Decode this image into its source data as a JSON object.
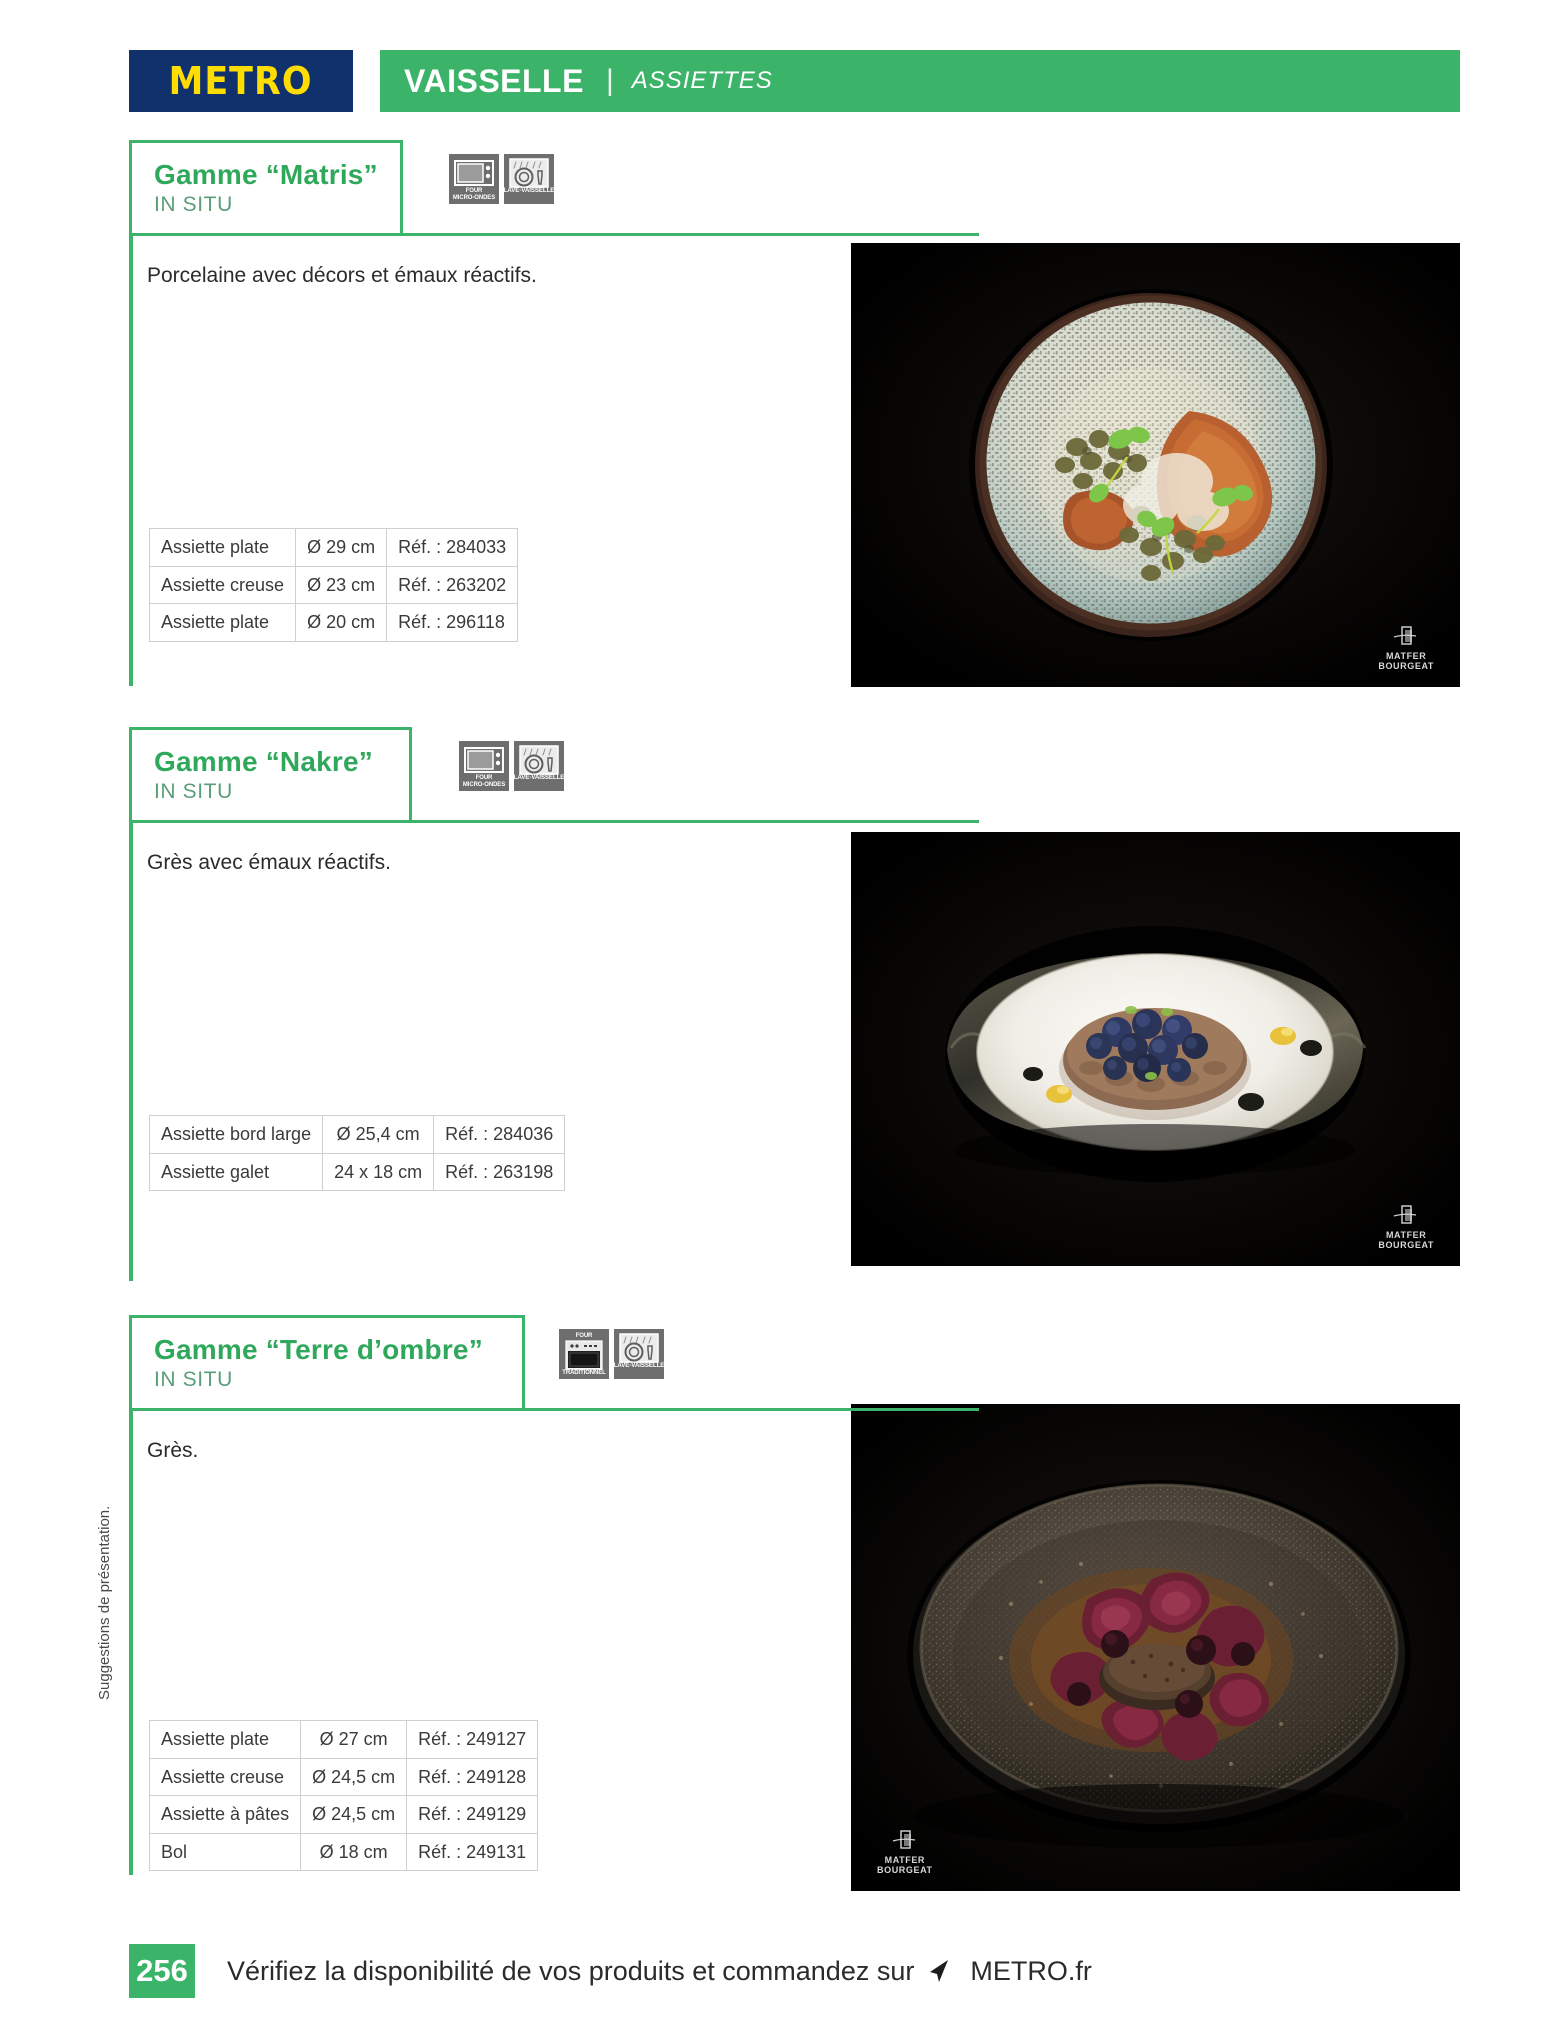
{
  "header": {
    "brand": "METRO",
    "category": "VAISSELLE",
    "separator": "|",
    "subcategory": "ASSIETTES",
    "brand_bg": "#10316b",
    "brand_fg": "#ffdd00",
    "bar_bg": "#3bb368"
  },
  "accent_color": "#3bb368",
  "sections": [
    {
      "title": "Gamme “Matris”",
      "subtitle": "IN SITU",
      "description": "Porcelaine avec décors et émaux réactifs.",
      "pictos": [
        {
          "icon": "microwave-icon",
          "line1": "FOUR",
          "line2": "MICRO-ONDES"
        },
        {
          "icon": "dishwasher-icon",
          "line1": "LAVE-VAISSELLE",
          "line2": ""
        }
      ],
      "rows": [
        {
          "name": "Assiette plate",
          "size": "Ø 29 cm",
          "ref": "Réf. : 284033"
        },
        {
          "name": "Assiette creuse",
          "size": "Ø 23 cm",
          "ref": "Réf. : 263202"
        },
        {
          "name": "Assiette plate",
          "size": "Ø 20 cm",
          "ref": "Réf. : 296118"
        }
      ],
      "photo": {
        "alt": "Assiette Matris avec poitrine de porc, lentilles et écume",
        "watermark": {
          "line1": "MATFER",
          "line2": "BOURGEAT"
        }
      }
    },
    {
      "title": "Gamme “Nakre”",
      "subtitle": "IN SITU",
      "description": "Grès avec émaux réactifs.",
      "pictos": [
        {
          "icon": "microwave-icon",
          "line1": "FOUR",
          "line2": "MICRO-ONDES"
        },
        {
          "icon": "dishwasher-icon",
          "line1": "LAVE-VAISSELLE",
          "line2": ""
        }
      ],
      "rows": [
        {
          "name": "Assiette bord large",
          "size": "Ø 25,4 cm",
          "ref": "Réf. : 284036"
        },
        {
          "name": "Assiette galet",
          "size": "24 x 18 cm",
          "ref": "Réf. : 263198"
        }
      ],
      "photo": {
        "alt": "Assiette Nakre avec dessert aux myrtilles",
        "watermark": {
          "line1": "MATFER",
          "line2": "BOURGEAT"
        }
      }
    },
    {
      "title": "Gamme “Terre d’ombre”",
      "subtitle": "IN SITU",
      "description": "Grès.",
      "pictos": [
        {
          "icon": "oven-icon",
          "line1": "FOUR",
          "line2": "TRADITIONNEL"
        },
        {
          "icon": "dishwasher-icon",
          "line1": "LAVE-VAISSELLE",
          "line2": ""
        }
      ],
      "rows": [
        {
          "name": "Assiette plate",
          "size": "Ø 27 cm",
          "ref": "Réf. : 249127"
        },
        {
          "name": "Assiette creuse",
          "size": "Ø 24,5 cm",
          "ref": "Réf. : 249128"
        },
        {
          "name": "Assiette à pâtes",
          "size": "Ø 24,5 cm",
          "ref": "Réf. : 249129"
        },
        {
          "name": "Bol",
          "size": "Ø 18 cm",
          "ref": "Réf. : 249131"
        }
      ],
      "photo": {
        "alt": "Assiette Terre d’ombre avec viande et radicchio",
        "watermark": {
          "line1": "MATFER",
          "line2": "BOURGEAT"
        }
      }
    }
  ],
  "side_note": "Suggestions de présentation.",
  "footer": {
    "page_number": "256",
    "text_before": "Vérifiez la disponibilité de vos produits et commandez sur",
    "site": "METRO.fr",
    "cursor_icon": "cursor-arrow-icon"
  }
}
